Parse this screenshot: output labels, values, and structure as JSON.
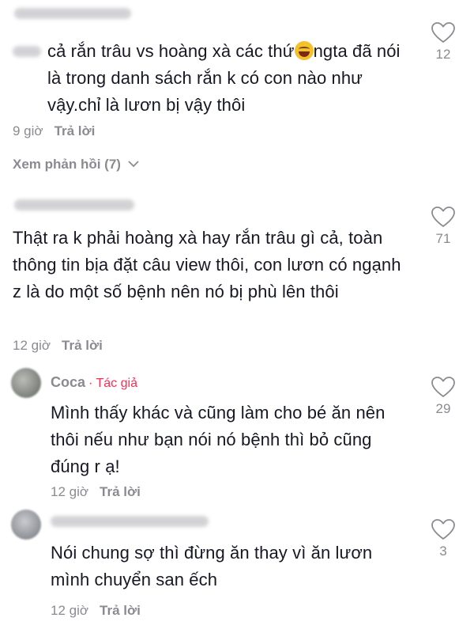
{
  "comments": [
    {
      "text_pre": "cả rắn trâu vs hoàng xà các thứ",
      "emoji": "laughing-emoji",
      "text_post": "ngta đã nói là trong danh sách rắn k có con nào như vậy.chỉ là lươn bị vậy thôi",
      "time": "9 giờ",
      "reply": "Trả lời",
      "likes": "12",
      "view_replies": "Xem phản hồi (7)"
    },
    {
      "text": "Thật ra k phải hoàng xà hay rắn trâu gì cả, toàn thông tin bịa đặt câu view thôi, con lươn có ngạnh z là do một số bệnh nên nó bị phù lên thôi",
      "time": "12 giờ",
      "reply": "Trả lời",
      "likes": "71"
    }
  ],
  "replies": [
    {
      "username": "Coca",
      "author_badge": "· Tác giả",
      "text": "Mình thấy khác và cũng làm cho bé ăn nên thôi nếu như bạn nói nó bệnh thì bỏ cũng đúng r ạ!",
      "time": "12 giờ",
      "reply": "Trả lời",
      "likes": "29"
    },
    {
      "text": "Nói chung sợ thì đừng ăn thay vì ăn lươn mình chuyển san ếch",
      "time": "12 giờ",
      "reply": "Trả lời",
      "likes": "3"
    }
  ],
  "colors": {
    "text": "#161823",
    "secondary": "#8a8b91",
    "author_badge": "#fe2c55",
    "background": "#ffffff"
  }
}
